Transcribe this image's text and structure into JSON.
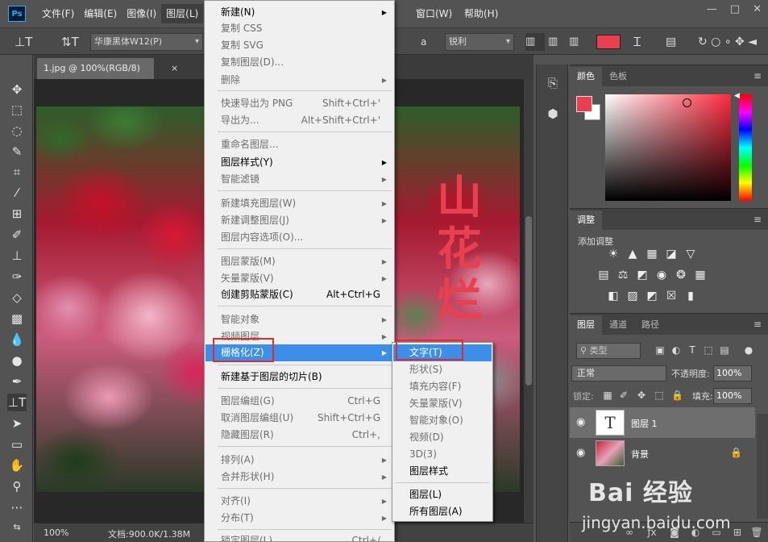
{
  "menubar": {
    "logo": "Ps",
    "items": [
      "文件(F)",
      "编辑(E)",
      "图像(I)",
      "图层(L)",
      "窗口(W)",
      "帮助(H)"
    ],
    "window_controls": [
      "—",
      "□",
      "✕"
    ]
  },
  "options": {
    "font_family": "华康黑体W12(P)",
    "antialias_icon": "a",
    "antialias": "锐利"
  },
  "document": {
    "tab_title": "1.jpg @ 100%(RGB/8)",
    "tab_close": "×",
    "canvas_text": "山花烂",
    "zoom": "100%",
    "doc_info": "文档:900.0K/1.38M"
  },
  "color_panel": {
    "tabs": [
      "颜色",
      "色板"
    ],
    "foreground": "#e8404f",
    "background": "#ffffff"
  },
  "adjust_panel": {
    "tab": "调整",
    "label": "添加调整"
  },
  "layers_panel": {
    "tabs": [
      "图层",
      "通道",
      "路径"
    ],
    "filter": "类型",
    "blend_mode": "正常",
    "opacity_label": "不透明度:",
    "opacity": "100%",
    "lock_label": "锁定:",
    "fill_label": "填充:",
    "fill": "100%",
    "layers": [
      {
        "name": "图层 1",
        "thumb": "T"
      },
      {
        "name": "背景"
      }
    ]
  },
  "layer_menu": {
    "items": [
      {
        "label": "新建(N)",
        "shortcut": "",
        "disabled": false
      },
      {
        "label": "复制 CSS",
        "shortcut": "",
        "disabled": true
      },
      {
        "label": "复制 SVG",
        "shortcut": "",
        "disabled": true
      },
      {
        "label": "复制图层(D)...",
        "shortcut": "",
        "disabled": true
      },
      {
        "label": "删除",
        "shortcut": "",
        "disabled": true
      },
      {
        "label": "快速导出为 PNG",
        "shortcut": "Shift+Ctrl+'",
        "disabled": true
      },
      {
        "label": "导出为...",
        "shortcut": "Alt+Shift+Ctrl+'",
        "disabled": true
      },
      {
        "label": "重命名图层...",
        "shortcut": "",
        "disabled": true
      },
      {
        "label": "图层样式(Y)",
        "shortcut": "",
        "disabled": false
      },
      {
        "label": "智能滤镜",
        "shortcut": "",
        "disabled": true
      },
      {
        "label": "新建填充图层(W)",
        "shortcut": "",
        "disabled": true
      },
      {
        "label": "新建调整图层(J)",
        "shortcut": "",
        "disabled": true
      },
      {
        "label": "图层内容选项(O)...",
        "shortcut": "",
        "disabled": true
      },
      {
        "label": "图层蒙版(M)",
        "shortcut": "",
        "disabled": true
      },
      {
        "label": "矢量蒙版(V)",
        "shortcut": "",
        "disabled": true
      },
      {
        "label": "创建剪贴蒙版(C)",
        "shortcut": "Alt+Ctrl+G",
        "disabled": false
      },
      {
        "label": "智能对象",
        "shortcut": "",
        "disabled": true
      },
      {
        "label": "视频图层",
        "shortcut": "",
        "disabled": true
      },
      {
        "label": "栅格化(Z)",
        "shortcut": "",
        "disabled": false
      },
      {
        "label": "新建基于图层的切片(B)",
        "shortcut": "",
        "disabled": false
      },
      {
        "label": "图层编组(G)",
        "shortcut": "Ctrl+G",
        "disabled": true
      },
      {
        "label": "取消图层编组(U)",
        "shortcut": "Shift+Ctrl+G",
        "disabled": true
      },
      {
        "label": "隐藏图层(R)",
        "shortcut": "Ctrl+,",
        "disabled": true
      },
      {
        "label": "排列(A)",
        "shortcut": "",
        "disabled": true
      },
      {
        "label": "合并形状(H)",
        "shortcut": "",
        "disabled": true
      },
      {
        "label": "对齐(I)",
        "shortcut": "",
        "disabled": true
      },
      {
        "label": "分布(T)",
        "shortcut": "",
        "disabled": true
      },
      {
        "label": "锁定图层(L)...",
        "shortcut": "Ctrl+/",
        "disabled": true
      }
    ]
  },
  "rasterize_submenu": {
    "items": [
      {
        "label": "文字(T)",
        "disabled": false
      },
      {
        "label": "形状(S)",
        "disabled": true
      },
      {
        "label": "填充内容(F)",
        "disabled": true
      },
      {
        "label": "矢量蒙版(V)",
        "disabled": true
      },
      {
        "label": "智能对象(O)",
        "disabled": true
      },
      {
        "label": "视频(D)",
        "disabled": true
      },
      {
        "label": "3D(3)",
        "disabled": true
      },
      {
        "label": "图层样式",
        "disabled": false
      },
      {
        "label": "图层(L)",
        "disabled": false
      },
      {
        "label": "所有图层(A)",
        "disabled": false
      }
    ]
  },
  "watermark": {
    "logo": "Bai 经验",
    "url": "jingyan.baidu.com"
  }
}
